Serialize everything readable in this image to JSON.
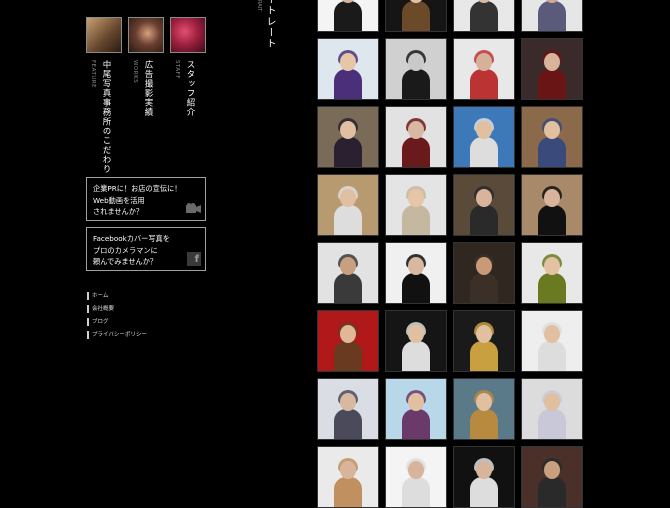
{
  "nav": {
    "items": [
      {
        "jp": "中尾写真事務所のこだわり",
        "en": "FEATURE"
      },
      {
        "jp": "広告撮影実績",
        "en": "WORKS"
      },
      {
        "jp": "スタッフ紹介",
        "en": "STAFF"
      }
    ]
  },
  "promos": [
    {
      "lines": [
        "企業PRに！お店の宣伝に！",
        "Web動画を活用",
        "されませんか？"
      ],
      "icon": "video-camera-icon"
    },
    {
      "lines": [
        "Facebookカバー写真を",
        "プロのカメラマンに",
        "頼んでみませんか？"
      ],
      "icon": "facebook-icon"
    }
  ],
  "footer_links": [
    "ホーム",
    "会社概要",
    "ブログ",
    "プライバシーポリシー"
  ],
  "page": {
    "title": "ートレート",
    "title_en": "RAIT"
  },
  "gallery": {
    "rows": 8,
    "cols": 4,
    "tiles": [
      {
        "bg": "#f4f4f4",
        "fig": "#1a1a1a",
        "skin": "#d8b49a"
      },
      {
        "bg": "#151515",
        "fig": "#6b4a2a",
        "skin": "#e0c2a8"
      },
      {
        "bg": "#e8e8e8",
        "fig": "#333",
        "skin": "#d9b8a0"
      },
      {
        "bg": "#e6e6e6",
        "fig": "#5a5a7a",
        "skin": "#d0a890"
      },
      {
        "bg": "#dfe7ee",
        "fig": "#4b2f7a",
        "skin": "#e6c6a6"
      },
      {
        "bg": "#d0d0d0",
        "fig": "#1a1a1a",
        "skin": "#c9c9c9"
      },
      {
        "bg": "#e8e8e8",
        "fig": "#b33",
        "skin": "#d6b098"
      },
      {
        "bg": "#3a2a2a",
        "fig": "#6a1515",
        "skin": "#d8b49a"
      },
      {
        "bg": "#7a6a58",
        "fig": "#2a2030",
        "skin": "#e0c0a0"
      },
      {
        "bg": "#e2e2e2",
        "fig": "#6a1a1a",
        "skin": "#d8b8a0"
      },
      {
        "bg": "#3d79b8",
        "fig": "#ddd",
        "skin": "#e0c0a0"
      },
      {
        "bg": "#8a6a4a",
        "fig": "#3a4a7a",
        "skin": "#e0c0a0"
      },
      {
        "bg": "#b89a70",
        "fig": "#ddd",
        "skin": "#e0c0a0"
      },
      {
        "bg": "#e4e4e4",
        "fig": "#c6b8a0",
        "skin": "#e6c6a6"
      },
      {
        "bg": "#5a4a3a",
        "fig": "#2a2a2a",
        "skin": "#d8b49a"
      },
      {
        "bg": "#a88a6a",
        "fig": "#111",
        "skin": "#d8b49a"
      },
      {
        "bg": "#e2e2e2",
        "fig": "#3a3a3a",
        "skin": "#c8a080"
      },
      {
        "bg": "#f0f0f0",
        "fig": "#111",
        "skin": "#d8b8a0"
      },
      {
        "bg": "#302820",
        "fig": "#3a3028",
        "skin": "#c89a78"
      },
      {
        "bg": "#e8e8e8",
        "fig": "#6a7a20",
        "skin": "#e2c2a2"
      },
      {
        "bg": "#b0181a",
        "fig": "#6a3a20",
        "skin": "#e0b898"
      },
      {
        "bg": "#151515",
        "fig": "#ddd",
        "skin": "#e0c0a0"
      },
      {
        "bg": "#1a1a1a",
        "fig": "#c8a040",
        "skin": "#e0c0a0"
      },
      {
        "bg": "#eeeeee",
        "fig": "#ddd",
        "skin": "#e0c0a0"
      },
      {
        "bg": "#dadde4",
        "fig": "#4a4a5a",
        "skin": "#d8b8a0"
      },
      {
        "bg": "#b8d8ea",
        "fig": "#6a3a6a",
        "skin": "#e0c0a0"
      },
      {
        "bg": "#5a7a8a",
        "fig": "#b88a40",
        "skin": "#e0c0a0"
      },
      {
        "bg": "#dcdcdc",
        "fig": "#c8c8d8",
        "skin": "#e0c0a0"
      },
      {
        "bg": "#eaeaea",
        "fig": "#c09060",
        "skin": "#d8b49a"
      },
      {
        "bg": "#f4f4f4",
        "fig": "#ddd",
        "skin": "#d8b49a"
      },
      {
        "bg": "#111",
        "fig": "#ddd",
        "skin": "#d8b49a"
      },
      {
        "bg": "#4a3028",
        "fig": "#2a2a2a",
        "skin": "#c8a080"
      }
    ]
  }
}
